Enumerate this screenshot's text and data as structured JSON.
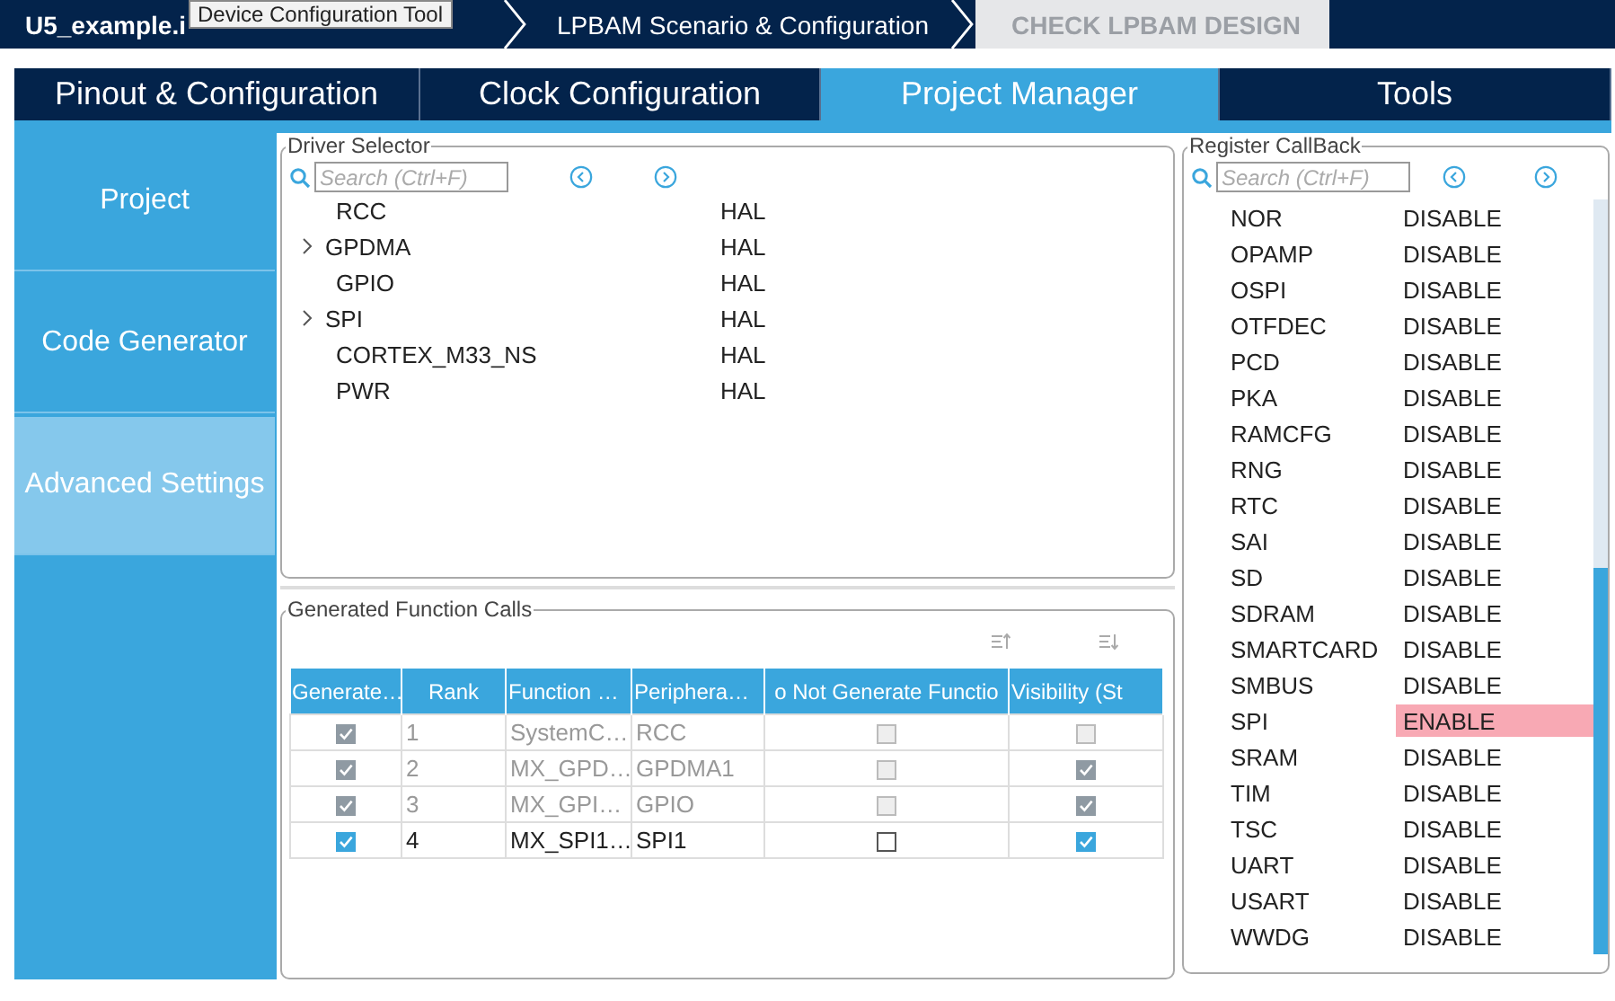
{
  "breadcrumb": [
    {
      "label": "U5_example.i",
      "kind": "file"
    },
    {
      "label": "LPBAM Scenario & Configuration",
      "kind": "step"
    },
    {
      "label": "CHECK LPBAM DESIGN",
      "kind": "action"
    }
  ],
  "tooltip": "Device Configuration Tool",
  "tabs": [
    {
      "label": "Pinout & Configuration",
      "selected": false
    },
    {
      "label": "Clock Configuration",
      "selected": false
    },
    {
      "label": "Project Manager",
      "selected": true
    },
    {
      "label": "Tools",
      "selected": false
    }
  ],
  "sidebar": {
    "items": [
      {
        "label": "Project",
        "selected": false
      },
      {
        "label": "Code Generator",
        "selected": false
      },
      {
        "label": "Advanced Settings",
        "selected": true
      }
    ]
  },
  "driver_selector": {
    "title": "Driver Selector",
    "search": {
      "placeholder": "Search (Ctrl+F)"
    },
    "rows": [
      {
        "name": "RCC",
        "driver": "HAL",
        "expandable": false
      },
      {
        "name": "GPDMA",
        "driver": "HAL",
        "expandable": true
      },
      {
        "name": "GPIO",
        "driver": "HAL",
        "expandable": false
      },
      {
        "name": "SPI",
        "driver": "HAL",
        "expandable": true
      },
      {
        "name": "CORTEX_M33_NS",
        "driver": "HAL",
        "expandable": false
      },
      {
        "name": "PWR",
        "driver": "HAL",
        "expandable": false
      }
    ]
  },
  "function_calls": {
    "title": "Generated Function Calls",
    "columns": [
      "Generate…",
      "Rank",
      "Function …",
      "Periphera…",
      "o Not Generate Functio",
      "Visibility (St"
    ],
    "rows": [
      {
        "generate": true,
        "rank": "1",
        "function": "SystemC…",
        "peripheral": "RCC",
        "not_generate": false,
        "visibility": false,
        "disabled": true
      },
      {
        "generate": true,
        "rank": "2",
        "function": "MX_GPD…",
        "peripheral": "GPDMA1",
        "not_generate": false,
        "visibility": true,
        "disabled": true
      },
      {
        "generate": true,
        "rank": "3",
        "function": "MX_GPI…",
        "peripheral": "GPIO",
        "not_generate": false,
        "visibility": true,
        "disabled": true
      },
      {
        "generate": true,
        "rank": "4",
        "function": "MX_SPI1…",
        "peripheral": "SPI1",
        "not_generate": false,
        "visibility": true,
        "disabled": false
      }
    ]
  },
  "register_callback": {
    "title": "Register CallBack",
    "search": {
      "placeholder": "Search (Ctrl+F)"
    },
    "rows": [
      {
        "name": "NOR",
        "value": "DISABLE",
        "highlighted": false
      },
      {
        "name": "OPAMP",
        "value": "DISABLE",
        "highlighted": false
      },
      {
        "name": "OSPI",
        "value": "DISABLE",
        "highlighted": false
      },
      {
        "name": "OTFDEC",
        "value": "DISABLE",
        "highlighted": false
      },
      {
        "name": "PCD",
        "value": "DISABLE",
        "highlighted": false
      },
      {
        "name": "PKA",
        "value": "DISABLE",
        "highlighted": false
      },
      {
        "name": "RAMCFG",
        "value": "DISABLE",
        "highlighted": false
      },
      {
        "name": "RNG",
        "value": "DISABLE",
        "highlighted": false
      },
      {
        "name": "RTC",
        "value": "DISABLE",
        "highlighted": false
      },
      {
        "name": "SAI",
        "value": "DISABLE",
        "highlighted": false
      },
      {
        "name": "SD",
        "value": "DISABLE",
        "highlighted": false
      },
      {
        "name": "SDRAM",
        "value": "DISABLE",
        "highlighted": false
      },
      {
        "name": "SMARTCARD",
        "value": "DISABLE",
        "highlighted": false
      },
      {
        "name": "SMBUS",
        "value": "DISABLE",
        "highlighted": false
      },
      {
        "name": "SPI",
        "value": "ENABLE",
        "highlighted": true
      },
      {
        "name": "SRAM",
        "value": "DISABLE",
        "highlighted": false
      },
      {
        "name": "TIM",
        "value": "DISABLE",
        "highlighted": false
      },
      {
        "name": "TSC",
        "value": "DISABLE",
        "highlighted": false
      },
      {
        "name": "UART",
        "value": "DISABLE",
        "highlighted": false
      },
      {
        "name": "USART",
        "value": "DISABLE",
        "highlighted": false
      },
      {
        "name": "WWDG",
        "value": "DISABLE",
        "highlighted": false
      }
    ]
  }
}
